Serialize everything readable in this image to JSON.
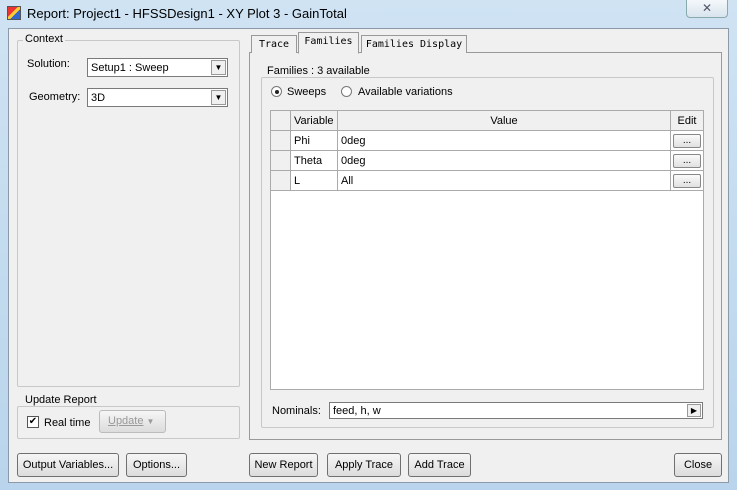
{
  "window": {
    "title": "Report: Project1 - HFSSDesign1 - XY Plot 3 - GainTotal",
    "close_glyph": "✕"
  },
  "context": {
    "label": "Context",
    "solution_label": "Solution:",
    "solution_value": "Setup1 : Sweep",
    "geometry_label": "Geometry:",
    "geometry_value": "3D"
  },
  "update_report": {
    "label": "Update Report",
    "realtime_label": "Real time",
    "realtime_checked": true,
    "update_label": "Update"
  },
  "tabs": [
    {
      "label": "Trace"
    },
    {
      "label": "Families",
      "active": true
    },
    {
      "label": "Families Display"
    }
  ],
  "families": {
    "label": "Families : 3 available",
    "radio_sweeps": "Sweeps",
    "radio_variations": "Available variations",
    "selected": "Sweeps",
    "columns": [
      "Variable",
      "Value",
      "Edit"
    ],
    "rows": [
      {
        "variable": "Phi",
        "value": "0deg",
        "edit": "..."
      },
      {
        "variable": "Theta",
        "value": "0deg",
        "edit": "..."
      },
      {
        "variable": "L",
        "value": "All",
        "edit": "..."
      }
    ],
    "nominals_label": "Nominals:",
    "nominals_value": "feed, h, w"
  },
  "buttons": {
    "output_variables": "Output Variables...",
    "options": "Options...",
    "new_report": "New Report",
    "apply_trace": "Apply Trace",
    "add_trace": "Add Trace",
    "close": "Close"
  }
}
